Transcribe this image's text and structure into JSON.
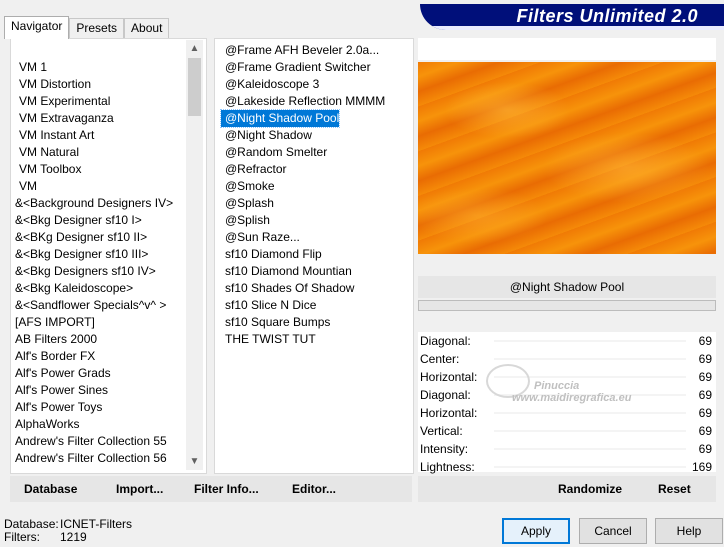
{
  "tabs": [
    "Navigator",
    "Presets",
    "About"
  ],
  "banner_title": "Filters Unlimited 2.0",
  "categories": [
    "VM 1",
    "VM Distortion",
    "VM Experimental",
    "VM Extravaganza",
    "VM Instant Art",
    "VM Natural",
    "VM Toolbox",
    "VM",
    "&<Background Designers IV>",
    "&<Bkg Designer sf10 I>",
    "&<BKg Designer sf10 II>",
    "&<Bkg Designer sf10 III>",
    "&<Bkg Designers sf10 IV>",
    "&<Bkg Kaleidoscope>",
    "&<Sandflower Specials^v^ >",
    "[AFS IMPORT]",
    "AB Filters 2000",
    "Alf's Border FX",
    "Alf's Power Grads",
    "Alf's Power Sines",
    "Alf's Power Toys",
    "AlphaWorks",
    "Andrew's Filter Collection 55",
    "Andrew's Filter Collection 56"
  ],
  "selected_category": "&<Background Designers IV>",
  "filters": [
    "@Frame AFH Beveler 2.0a...",
    "@Frame Gradient Switcher",
    "@Kaleidoscope 3",
    "@Lakeside Reflection MMMM",
    "@Night Shadow Pool",
    "@Night Shadow",
    "@Random Smelter",
    "@Refractor",
    "@Smoke",
    "@Splash",
    "@Splish",
    "@Sun Raze...",
    "sf10 Diamond Flip",
    "sf10 Diamond Mountian",
    "sf10 Shades Of Shadow",
    "sf10 Slice N Dice",
    "sf10 Square Bumps",
    "THE TWIST TUT"
  ],
  "selected_filter": "@Night Shadow Pool",
  "filter_name": "@Night Shadow Pool",
  "params": [
    {
      "label": "Diagonal:",
      "value": "69"
    },
    {
      "label": "Center:",
      "value": "69"
    },
    {
      "label": "Horizontal:",
      "value": "69"
    },
    {
      "label": "Diagonal:",
      "value": "69"
    },
    {
      "label": "Horizontal:",
      "value": "69"
    },
    {
      "label": "Vertical:",
      "value": "69"
    },
    {
      "label": "Intensity:",
      "value": "69"
    },
    {
      "label": "Lightness:",
      "value": "169"
    }
  ],
  "watermark": {
    "name": "Pinuccia",
    "url": "www.maidiregrafica.eu"
  },
  "bottom_left_buttons": [
    "Database",
    "Import...",
    "Filter Info...",
    "Editor..."
  ],
  "bottom_right_buttons": [
    "Randomize",
    "Reset"
  ],
  "status": {
    "database_label": "Database:",
    "database_value": "ICNET-Filters",
    "filters_label": "Filters:",
    "filters_value": "1219"
  },
  "dialog_buttons": {
    "apply": "Apply",
    "cancel": "Cancel",
    "help": "Help"
  }
}
